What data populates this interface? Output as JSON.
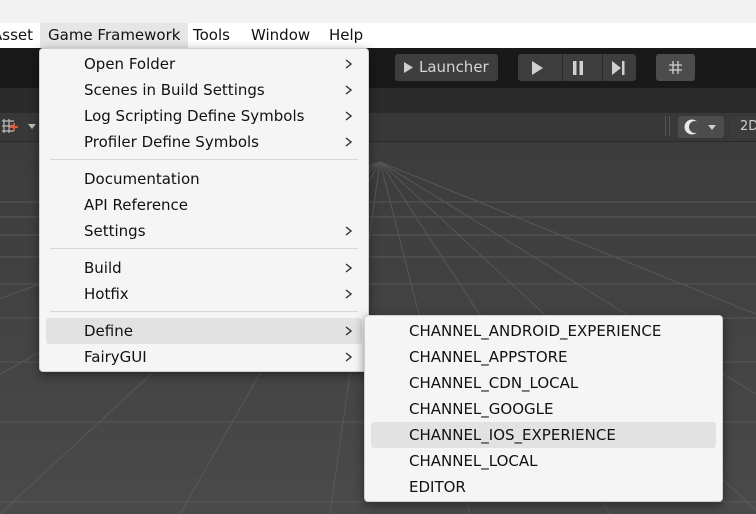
{
  "menubar": {
    "items": [
      {
        "label": "Asset"
      },
      {
        "label": "Game Framework"
      },
      {
        "label": "Tools"
      },
      {
        "label": "Window"
      },
      {
        "label": "Help"
      }
    ]
  },
  "toolbar": {
    "launcher_label": "Launcher",
    "scene_2d_label": "2D"
  },
  "game_framework_menu": {
    "items": [
      {
        "label": "Open Folder",
        "has_submenu": true
      },
      {
        "label": "Scenes in Build Settings",
        "has_submenu": true
      },
      {
        "label": "Log Scripting Define Symbols",
        "has_submenu": true
      },
      {
        "label": "Profiler Define Symbols",
        "has_submenu": true
      },
      {
        "label": "Documentation",
        "has_submenu": false
      },
      {
        "label": "API Reference",
        "has_submenu": false
      },
      {
        "label": "Settings",
        "has_submenu": true
      },
      {
        "label": "Build",
        "has_submenu": true
      },
      {
        "label": "Hotfix",
        "has_submenu": true
      },
      {
        "label": "Define",
        "has_submenu": true,
        "highlighted": true
      },
      {
        "label": "FairyGUI",
        "has_submenu": true
      }
    ]
  },
  "define_submenu": {
    "items": [
      {
        "label": "CHANNEL_ANDROID_EXPERIENCE"
      },
      {
        "label": "CHANNEL_APPSTORE"
      },
      {
        "label": "CHANNEL_CDN_LOCAL"
      },
      {
        "label": "CHANNEL_GOOGLE"
      },
      {
        "label": "CHANNEL_IOS_EXPERIENCE",
        "highlighted": true
      },
      {
        "label": "CHANNEL_LOCAL"
      },
      {
        "label": "EDITOR"
      }
    ]
  },
  "colors": {
    "menu_bg": "#f5f5f5",
    "menu_highlight": "#e2e2e2",
    "toolbar_bg": "#191919",
    "scene_bg": "#474747"
  }
}
